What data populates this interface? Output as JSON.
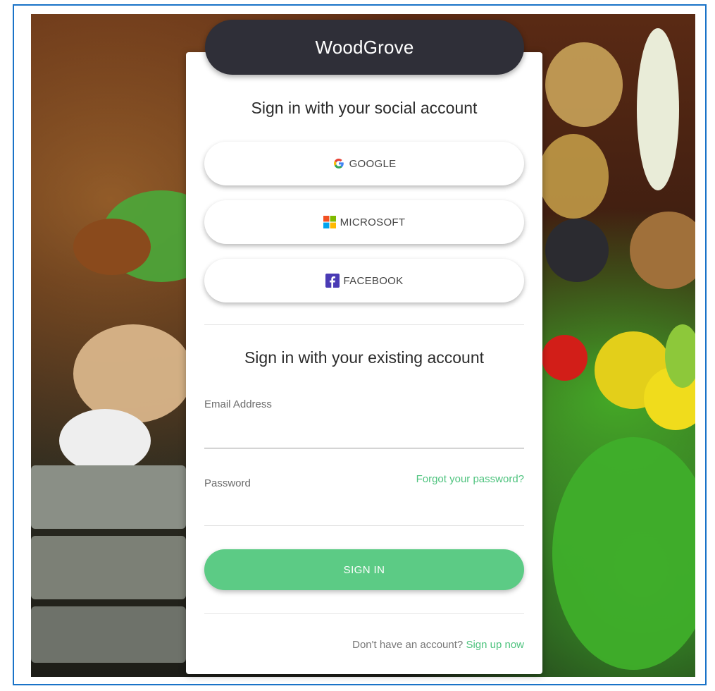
{
  "brand": {
    "name": "WoodGrove"
  },
  "social": {
    "heading": "Sign in with your social account",
    "providers": [
      {
        "label": "GOOGLE",
        "icon": "google-icon"
      },
      {
        "label": "MICROSOFT",
        "icon": "microsoft-icon"
      },
      {
        "label": "FACEBOOK",
        "icon": "facebook-icon"
      }
    ]
  },
  "local": {
    "heading": "Sign in with your existing account",
    "email": {
      "label": "Email Address",
      "value": ""
    },
    "password": {
      "label": "Password",
      "value": ""
    },
    "forgot_link": "Forgot your password?",
    "submit_label": "SIGN IN",
    "signup_prompt": "Don't have an account?",
    "signup_link": "Sign up now"
  },
  "colors": {
    "brand_bar": "#2f2f38",
    "accent_green": "#5ccb85",
    "frame_blue": "#1a73c8",
    "facebook_purple": "#4a3bb5"
  }
}
